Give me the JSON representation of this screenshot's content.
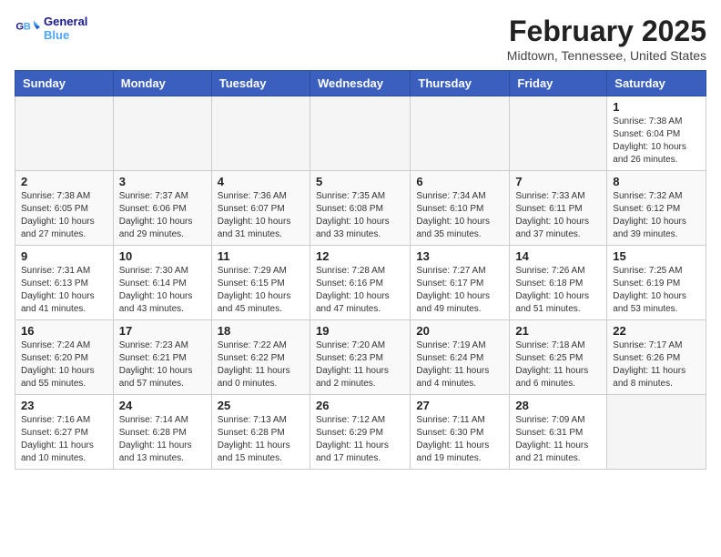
{
  "logo": {
    "text_general": "General",
    "text_blue": "Blue"
  },
  "title": "February 2025",
  "location": "Midtown, Tennessee, United States",
  "days_of_week": [
    "Sunday",
    "Monday",
    "Tuesday",
    "Wednesday",
    "Thursday",
    "Friday",
    "Saturday"
  ],
  "weeks": [
    [
      {
        "day": "",
        "detail": ""
      },
      {
        "day": "",
        "detail": ""
      },
      {
        "day": "",
        "detail": ""
      },
      {
        "day": "",
        "detail": ""
      },
      {
        "day": "",
        "detail": ""
      },
      {
        "day": "",
        "detail": ""
      },
      {
        "day": "1",
        "detail": "Sunrise: 7:38 AM\nSunset: 6:04 PM\nDaylight: 10 hours\nand 26 minutes."
      }
    ],
    [
      {
        "day": "2",
        "detail": "Sunrise: 7:38 AM\nSunset: 6:05 PM\nDaylight: 10 hours\nand 27 minutes."
      },
      {
        "day": "3",
        "detail": "Sunrise: 7:37 AM\nSunset: 6:06 PM\nDaylight: 10 hours\nand 29 minutes."
      },
      {
        "day": "4",
        "detail": "Sunrise: 7:36 AM\nSunset: 6:07 PM\nDaylight: 10 hours\nand 31 minutes."
      },
      {
        "day": "5",
        "detail": "Sunrise: 7:35 AM\nSunset: 6:08 PM\nDaylight: 10 hours\nand 33 minutes."
      },
      {
        "day": "6",
        "detail": "Sunrise: 7:34 AM\nSunset: 6:10 PM\nDaylight: 10 hours\nand 35 minutes."
      },
      {
        "day": "7",
        "detail": "Sunrise: 7:33 AM\nSunset: 6:11 PM\nDaylight: 10 hours\nand 37 minutes."
      },
      {
        "day": "8",
        "detail": "Sunrise: 7:32 AM\nSunset: 6:12 PM\nDaylight: 10 hours\nand 39 minutes."
      }
    ],
    [
      {
        "day": "9",
        "detail": "Sunrise: 7:31 AM\nSunset: 6:13 PM\nDaylight: 10 hours\nand 41 minutes."
      },
      {
        "day": "10",
        "detail": "Sunrise: 7:30 AM\nSunset: 6:14 PM\nDaylight: 10 hours\nand 43 minutes."
      },
      {
        "day": "11",
        "detail": "Sunrise: 7:29 AM\nSunset: 6:15 PM\nDaylight: 10 hours\nand 45 minutes."
      },
      {
        "day": "12",
        "detail": "Sunrise: 7:28 AM\nSunset: 6:16 PM\nDaylight: 10 hours\nand 47 minutes."
      },
      {
        "day": "13",
        "detail": "Sunrise: 7:27 AM\nSunset: 6:17 PM\nDaylight: 10 hours\nand 49 minutes."
      },
      {
        "day": "14",
        "detail": "Sunrise: 7:26 AM\nSunset: 6:18 PM\nDaylight: 10 hours\nand 51 minutes."
      },
      {
        "day": "15",
        "detail": "Sunrise: 7:25 AM\nSunset: 6:19 PM\nDaylight: 10 hours\nand 53 minutes."
      }
    ],
    [
      {
        "day": "16",
        "detail": "Sunrise: 7:24 AM\nSunset: 6:20 PM\nDaylight: 10 hours\nand 55 minutes."
      },
      {
        "day": "17",
        "detail": "Sunrise: 7:23 AM\nSunset: 6:21 PM\nDaylight: 10 hours\nand 57 minutes."
      },
      {
        "day": "18",
        "detail": "Sunrise: 7:22 AM\nSunset: 6:22 PM\nDaylight: 11 hours\nand 0 minutes."
      },
      {
        "day": "19",
        "detail": "Sunrise: 7:20 AM\nSunset: 6:23 PM\nDaylight: 11 hours\nand 2 minutes."
      },
      {
        "day": "20",
        "detail": "Sunrise: 7:19 AM\nSunset: 6:24 PM\nDaylight: 11 hours\nand 4 minutes."
      },
      {
        "day": "21",
        "detail": "Sunrise: 7:18 AM\nSunset: 6:25 PM\nDaylight: 11 hours\nand 6 minutes."
      },
      {
        "day": "22",
        "detail": "Sunrise: 7:17 AM\nSunset: 6:26 PM\nDaylight: 11 hours\nand 8 minutes."
      }
    ],
    [
      {
        "day": "23",
        "detail": "Sunrise: 7:16 AM\nSunset: 6:27 PM\nDaylight: 11 hours\nand 10 minutes."
      },
      {
        "day": "24",
        "detail": "Sunrise: 7:14 AM\nSunset: 6:28 PM\nDaylight: 11 hours\nand 13 minutes."
      },
      {
        "day": "25",
        "detail": "Sunrise: 7:13 AM\nSunset: 6:28 PM\nDaylight: 11 hours\nand 15 minutes."
      },
      {
        "day": "26",
        "detail": "Sunrise: 7:12 AM\nSunset: 6:29 PM\nDaylight: 11 hours\nand 17 minutes."
      },
      {
        "day": "27",
        "detail": "Sunrise: 7:11 AM\nSunset: 6:30 PM\nDaylight: 11 hours\nand 19 minutes."
      },
      {
        "day": "28",
        "detail": "Sunrise: 7:09 AM\nSunset: 6:31 PM\nDaylight: 11 hours\nand 21 minutes."
      },
      {
        "day": "",
        "detail": ""
      }
    ]
  ]
}
